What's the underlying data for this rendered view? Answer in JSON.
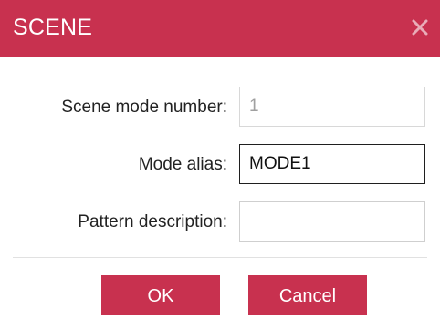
{
  "dialog": {
    "title": "SCENE",
    "close_icon": "close-icon"
  },
  "form": {
    "scene_mode_number": {
      "label": "Scene mode number:",
      "value": "1"
    },
    "mode_alias": {
      "label": "Mode alias:",
      "value": "MODE1"
    },
    "pattern_description": {
      "label": "Pattern description:",
      "value": ""
    }
  },
  "buttons": {
    "ok_label": "OK",
    "cancel_label": "Cancel"
  },
  "colors": {
    "accent": "#c8314f",
    "title_text": "#ffffff"
  }
}
